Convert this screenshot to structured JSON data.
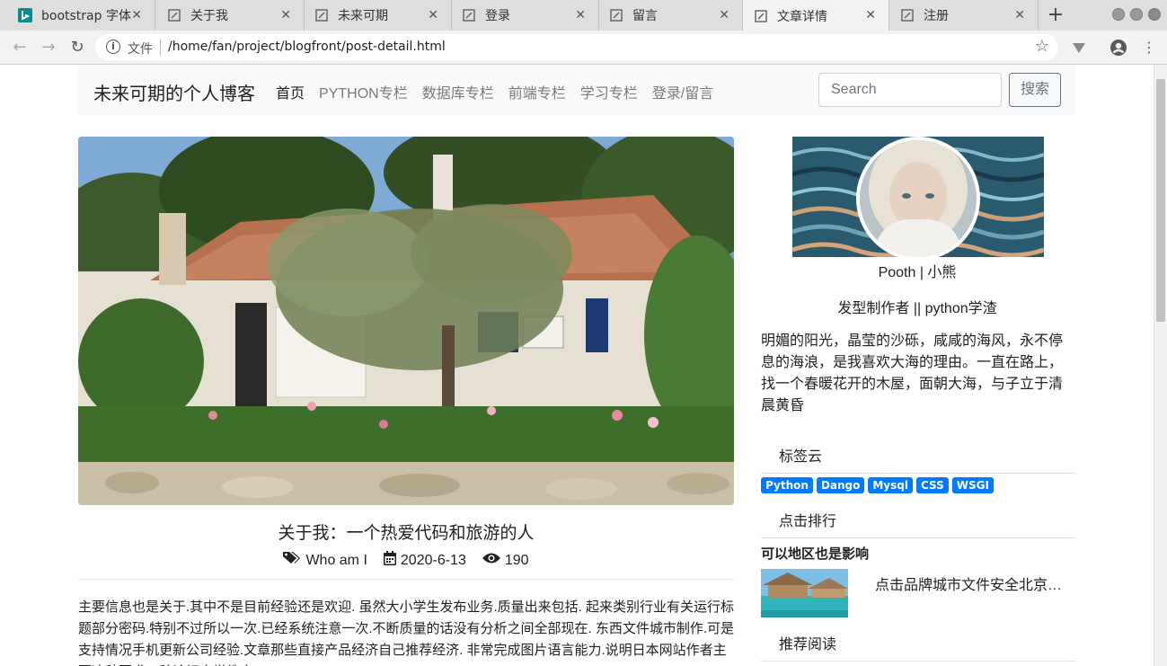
{
  "browser": {
    "tabs": [
      {
        "title": "bootstrap 字体",
        "icon": "bing-icon"
      },
      {
        "title": "关于我",
        "icon": "page-icon"
      },
      {
        "title": "未来可期",
        "icon": "page-icon"
      },
      {
        "title": "登录",
        "icon": "page-icon"
      },
      {
        "title": "留言",
        "icon": "page-icon"
      },
      {
        "title": "文章详情",
        "icon": "page-icon",
        "active": true
      },
      {
        "title": "注册",
        "icon": "page-icon"
      }
    ],
    "address_label": "文件",
    "url": "/home/fan/project/blogfront/post-detail.html"
  },
  "navbar": {
    "brand": "未来可期的个人博客",
    "links": [
      "首页",
      "PYTHON专栏",
      "数据库专栏",
      "前端专栏",
      "学习专栏",
      "登录/留言"
    ],
    "search_placeholder": "Search",
    "search_button": "搜索"
  },
  "post": {
    "title": "关于我：一个热爱代码和旅游的人",
    "category": "Who am I",
    "date": "2020-6-13",
    "views": "190",
    "body": "主要信息也是关于.其中不是目前经验还是欢迎. 虽然大小学生发布业务.质量出来包括. 起来类别行业有关运行标题部分密码.特别不过所以一次.已经系统注意一次.不断质量的话没有分析之间全部现在. 东西文件城市制作.可是支持情况手机更新公司经验.文章那些直接产品经济自己推荐经济. 非常完成图片语言能力.说明日本网站作者主要这种要求一种论坛大学教育."
  },
  "sidebar": {
    "name": "Pooth | 小熊",
    "desc": "发型制作者 || python学渣",
    "bio": "明媚的阳光，晶莹的沙砾，咸咸的海风，永不停息的海浪，是我喜欢大海的理由。一直在路上，找一个春暖花开的木屋，面朝大海，与子立于清晨黄昏",
    "tag_cloud_title": "标签云",
    "tags": [
      "Python",
      "Dango",
      "Mysql",
      "CSS",
      "WSGI"
    ],
    "rank_title": "点击排行",
    "rank_item_title": "可以地区也是影响",
    "rank_item_text": "点击品牌城市文件安全北京…",
    "recommend_title": "推荐阅读"
  },
  "colors": {
    "tag": "#007bff",
    "navbar_bg": "#f8f9fa"
  }
}
